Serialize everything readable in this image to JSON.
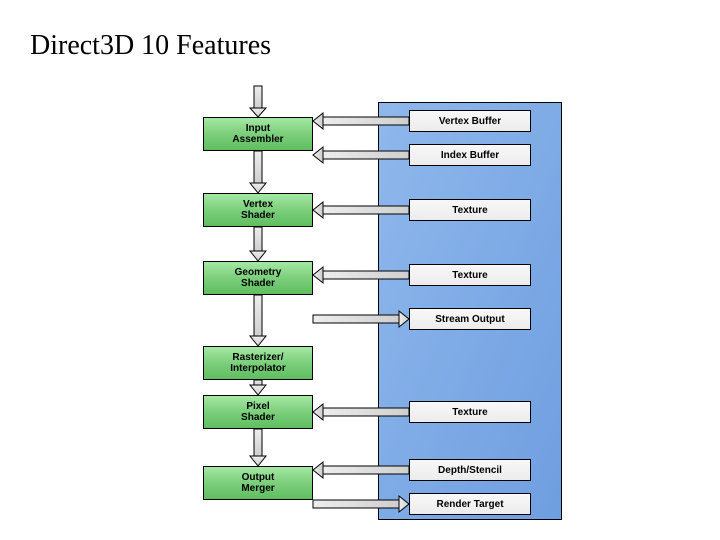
{
  "title": "Direct3D 10 Features",
  "stages": {
    "ia1": "Input",
    "ia2": "Assembler",
    "vs1": "Vertex",
    "vs2": "Shader",
    "gs1": "Geometry",
    "gs2": "Shader",
    "ri1": "Rasterizer/",
    "ri2": "Interpolator",
    "ps1": "Pixel",
    "ps2": "Shader",
    "om1": "Output",
    "om2": "Merger"
  },
  "mem": {
    "vb": "Vertex Buffer",
    "ib": "Index Buffer",
    "tex_vs": "Texture",
    "tex_gs": "Texture",
    "so": "Stream Output",
    "tex_ps": "Texture",
    "ds": "Depth/Stencil",
    "rt": "Render Target"
  }
}
